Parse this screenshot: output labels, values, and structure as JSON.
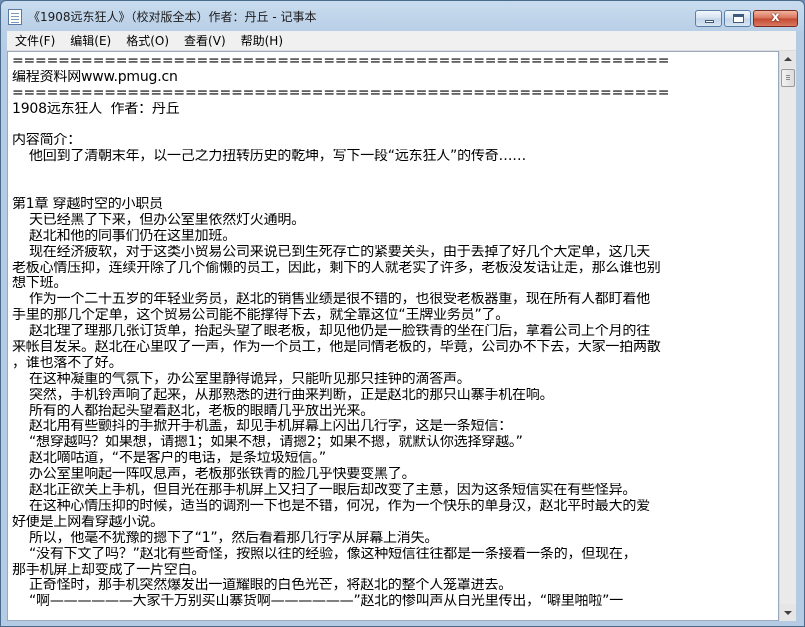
{
  "window": {
    "title": "《1908远东狂人》（校对版全本）作者：丹丘 - 记事本",
    "close_glyph": "x"
  },
  "menu": [
    "文件(F)",
    "编辑(E)",
    "格式(O)",
    "查看(V)",
    "帮助(H)"
  ],
  "editor": {
    "lines": [
      "=========================================================",
      "编程资料网www.pmug.cn",
      "=========================================================",
      "1908远东狂人  作者：丹丘",
      "",
      "内容简介：",
      "    他回到了清朝末年，以一己之力扭转历史的乾坤，写下一段“远东狂人”的传奇……",
      "",
      "",
      "第1章 穿越时空的小职员",
      "    天已经黑了下来，但办公室里依然灯火通明。",
      "    赵北和他的同事们仍在这里加班。",
      "    现在经济疲软，对于这类小贸易公司来说已到生死存亡的紧要关头，由于丢掉了好几个大定单，这几天",
      "老板心情压抑，连续开除了几个偷懒的员工，因此，剩下的人就老实了许多，老板没发话让走，那么谁也别",
      "想下班。",
      "    作为一个二十五岁的年轻业务员，赵北的销售业绩是很不错的，也很受老板器重，现在所有人都盯着他",
      "手里的那几个定单，这个贸易公司能不能撑得下去，就全靠这位“王牌业务员”了。",
      "    赵北理了理那几张订货单，抬起头望了眼老板，却见他仍是一脸铁青的坐在门后，拿着公司上个月的往",
      "来帐目发呆。赵北在心里叹了一声，作为一个员工，他是同情老板的，毕竟，公司办不下去，大家一拍两散",
      "，谁也落不了好。",
      "    在这种凝重的气氛下，办公室里静得诡异，只能听见那只挂钟的滴答声。",
      "    突然，手机铃声响了起来，从那熟悉的进行曲来判断，正是赵北的那只山寨手机在响。",
      "    所有的人都抬起头望着赵北，老板的眼睛几乎放出光来。",
      "    赵北用有些颤抖的手掀开手机盖，却见手机屏幕上闪出几行字，这是一条短信：",
      "    “想穿越吗？如果想，请摁1；如果不想，请摁2；如果不摁，就默认你选择穿越。”",
      "    赵北嘀咕道，“不是客户的电话，是条垃圾短信。”",
      "    办公室里响起一阵叹息声，老板那张铁青的脸几乎快要变黑了。",
      "    赵北正欲关上手机，但目光在那手机屏上又扫了一眼后却改变了主意，因为这条短信实在有些怪异。",
      "    在这种心情压抑的时候，适当的调剂一下也是不错，何况，作为一个快乐的单身汉，赵北平时最大的爱",
      "好便是上网看穿越小说。",
      "    所以，他毫不犹豫的摁下了“1”，然后看着那几行字从屏幕上消失。",
      "    “没有下文了吗？”赵北有些奇怪，按照以往的经验，像这种短信往往都是一条接着一条的，但现在，",
      "那手机屏上却变成了一片空白。",
      "    正奇怪时，那手机突然爆发出一道耀眼的白色光芒，将赵北的整个人笼罩进去。",
      "    “啊——————大家千万别买山寨货啊——————”赵北的惨叫声从白光里传出，“噼里啪啦”一"
    ]
  }
}
